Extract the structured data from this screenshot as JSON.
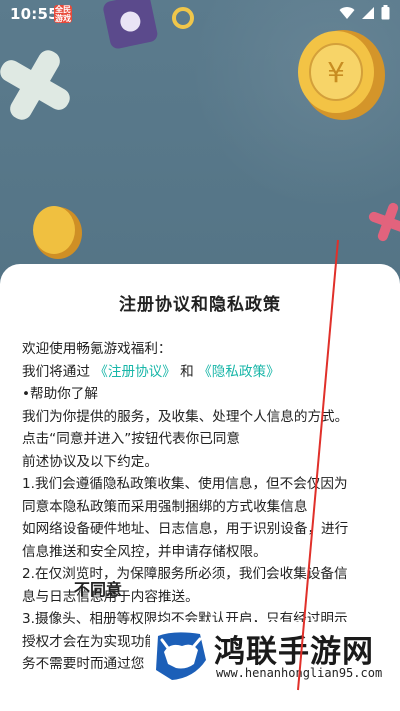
{
  "status_bar": {
    "time": "10:55",
    "badge_text_1": "全民",
    "badge_text_2": "游戏",
    "icons": [
      "wifi-icon",
      "signal-icon",
      "battery-icon"
    ]
  },
  "dialog": {
    "title": "注册协议和隐私政策",
    "lines": {
      "l1": "欢迎使用畅氪游戏福利：",
      "l2_prefix": "我们将通过 ",
      "l2_link1": "《注册协议》",
      "l2_mid": " 和 ",
      "l2_link2": "《隐私政策》",
      "l3": "•帮助你了解",
      "l4": "我们为你提供的服务，及收集、处理个人信息的方式。",
      "l5": "点击“同意并进入”按钮代表你已同意",
      "l6": "前述协议及以下约定。",
      "l7": "1.我们会遵循隐私政策收集、使用信息，但不会仅因为",
      "l8": "同意本隐私政策而采用强制捆绑的方式收集信息",
      "l9": "如网络设备硬件地址、日志信息，用于识别设备，进行",
      "l10": "信息推送和安全风控，并申请存储权限。",
      "l11": "2.在仅浏览时，为保障服务所必须，我们会收集设备信",
      "l12": "息与日志信息用于内容推送。",
      "l13": "3.摄像头、相册等权限均不会默认开启，只有经过明示",
      "l14": "授权才会在为实现功能或服务时使用，不会在功能或服",
      "l15": "务不需要时而通过您"
    },
    "disagree_label": "不同意"
  },
  "watermark": {
    "title": "鸿联手游网",
    "url": "www.henanhonglian95.com"
  },
  "colors": {
    "link": "#18b6a8",
    "background": "#4f7082",
    "overlay_line": "#e0302a"
  }
}
